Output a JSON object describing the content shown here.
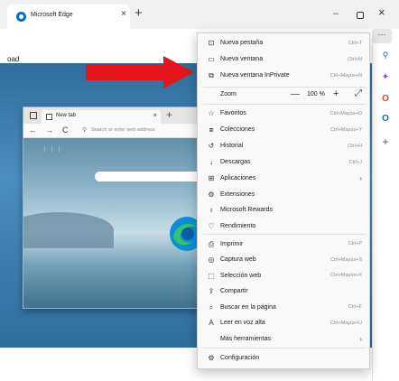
{
  "browser": {
    "tab_title": "Microsoft Edge",
    "tab_close": "×",
    "new_tab": "+",
    "min": "–",
    "close": "×",
    "more": "···"
  },
  "page": {
    "snippet": "oad"
  },
  "inner_browser": {
    "tab_title": "New tab",
    "tab_close": "×",
    "new_tab": "+",
    "back": "←",
    "forward": "→",
    "refresh": "C",
    "search_icon": "⚲",
    "address_placeholder": "Search or enter web address",
    "apps_grid": "⋮⋮⋮"
  },
  "menu": {
    "items": [
      {
        "icon": "new-tab-icon",
        "glyph": "⊡",
        "label": "Nueva pestaña",
        "shortcut": "Ctrl+T"
      },
      {
        "icon": "new-window-icon",
        "glyph": "▭",
        "label": "Nueva ventana",
        "shortcut": "Ctrl+N"
      },
      {
        "icon": "inprivate-icon",
        "glyph": "⧉",
        "label": "Nueva ventana InPrivate",
        "shortcut": "Ctrl+Mayús+N"
      },
      {
        "icon": "favorites-icon",
        "glyph": "☆",
        "label": "Favoritos",
        "shortcut": "Ctrl+Mayús+O"
      },
      {
        "icon": "collections-icon",
        "glyph": "⧈",
        "label": "Colecciones",
        "shortcut": "Ctrl+Mayús+Y"
      },
      {
        "icon": "history-icon",
        "glyph": "↺",
        "label": "Historial",
        "shortcut": "Ctrl+H"
      },
      {
        "icon": "downloads-icon",
        "glyph": "↓",
        "label": "Descargas",
        "shortcut": "Ctrl+J"
      },
      {
        "icon": "apps-icon",
        "glyph": "⊞",
        "label": "Aplicaciones",
        "shortcut": ""
      },
      {
        "icon": "extensions-icon",
        "glyph": "⚙",
        "label": "Extensiones",
        "shortcut": ""
      },
      {
        "icon": "rewards-icon",
        "glyph": "♁",
        "label": "Microsoft Rewards",
        "shortcut": ""
      },
      {
        "icon": "performance-icon",
        "glyph": "♡",
        "label": "Rendimiento",
        "shortcut": ""
      },
      {
        "icon": "print-icon",
        "glyph": "⎙",
        "label": "Imprimir",
        "shortcut": "Ctrl+P"
      },
      {
        "icon": "screenshot-icon",
        "glyph": "◎",
        "label": "Captura web",
        "shortcut": "Ctrl+Mayús+S"
      },
      {
        "icon": "web-select-icon",
        "glyph": "⬚",
        "label": "Selección web",
        "shortcut": "Ctrl+Mayús+X"
      },
      {
        "icon": "share-icon",
        "glyph": "⇪",
        "label": "Compartir",
        "shortcut": ""
      },
      {
        "icon": "find-icon",
        "glyph": "⌕",
        "label": "Buscar en la página",
        "shortcut": "Ctrl+F"
      },
      {
        "icon": "read-aloud-icon",
        "glyph": "A",
        "label": "Leer en voz alta",
        "shortcut": "Ctrl+Mayús+U"
      },
      {
        "icon": "",
        "glyph": "",
        "label": "Más herramientas",
        "shortcut": ""
      },
      {
        "icon": "settings-icon",
        "glyph": "⚙",
        "label": "Configuración",
        "shortcut": ""
      }
    ],
    "zoom": {
      "label": "Zoom",
      "minus": "—",
      "value": "100 %",
      "plus": "+",
      "expand": "⤢"
    },
    "chevron": "›"
  },
  "sidebar": {
    "search": "🔍",
    "copilot": "✦",
    "office": "O",
    "outlook": "O",
    "add": "+"
  },
  "colors": {
    "arrow": "#e4161c",
    "accent": "#0a6cc2"
  }
}
